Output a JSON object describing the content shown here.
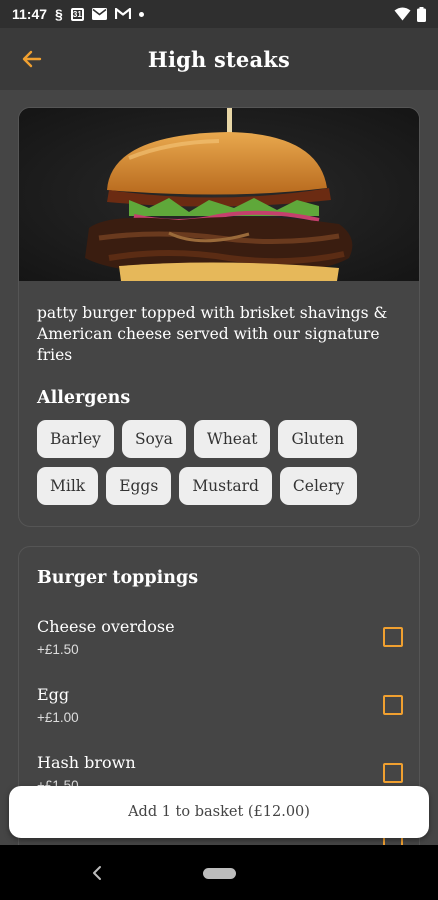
{
  "status_bar": {
    "time": "11:47",
    "icons": [
      "s-icon",
      "calendar-icon",
      "mail-icon",
      "gmail-icon",
      "dot-icon",
      "wifi-icon",
      "battery-icon"
    ],
    "calendar_text": "31"
  },
  "header": {
    "title": "High steaks",
    "back_icon": "arrow-left-icon"
  },
  "product": {
    "image": "burger-photo",
    "description": "patty burger topped with brisket shavings & American cheese served with our signature fries"
  },
  "allergens": {
    "title": "Allergens",
    "items": [
      "Barley",
      "Soya",
      "Wheat",
      "Gluten",
      "Milk",
      "Eggs",
      "Mustard",
      "Celery"
    ]
  },
  "toppings": {
    "title": "Burger toppings",
    "items": [
      {
        "name": "Cheese overdose",
        "price": "+£1.50"
      },
      {
        "name": "Egg",
        "price": "+£1.00"
      },
      {
        "name": "Hash brown",
        "price": "+£1.50"
      }
    ]
  },
  "basket": {
    "label": "Add 1 to basket (£12.00)"
  },
  "colors": {
    "accent": "#f0a030",
    "background": "#454545",
    "app_bar": "#3a3a3a"
  }
}
